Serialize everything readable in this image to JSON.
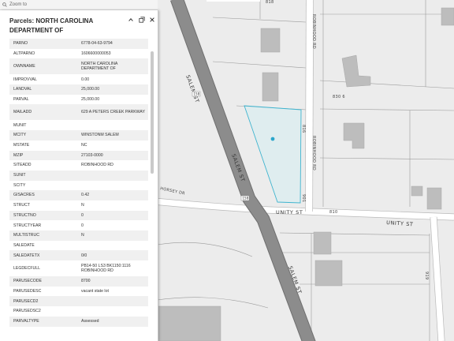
{
  "toolbar": {
    "zoom_label": "Zoom to"
  },
  "popup": {
    "title": "Parcels: NORTH CAROLINA DEPARTMENT OF",
    "rows": [
      {
        "key": "PARNO",
        "value": "6778-04-63-9794"
      },
      {
        "key": "ALTPARNO",
        "value": "1606600000053"
      },
      {
        "key": "OWNNAME",
        "value": "NORTH CAROLINA DEPARTMENT OF"
      },
      {
        "key": "IMPROVVAL",
        "value": "0.00"
      },
      {
        "key": "LANDVAL",
        "value": "25,000.00"
      },
      {
        "key": "PARVAL",
        "value": "25,000.00"
      },
      {
        "key": "MAILADD",
        "value": "629 A PETERS CREEK PARKWAY"
      },
      {
        "key": "MUNIT",
        "value": ""
      },
      {
        "key": "MCITY",
        "value": "WINSTONM SALEM"
      },
      {
        "key": "MSTATE",
        "value": "NC"
      },
      {
        "key": "MZIP",
        "value": "27103-0000"
      },
      {
        "key": "SITEADD",
        "value": "ROBINHOOD RD"
      },
      {
        "key": "SUNIT",
        "value": ""
      },
      {
        "key": "SCITY",
        "value": ""
      },
      {
        "key": "GISACRES",
        "value": "0.42"
      },
      {
        "key": "STRUCT",
        "value": "N"
      },
      {
        "key": "STRUCTNO",
        "value": "0"
      },
      {
        "key": "STRUCTYEAR",
        "value": "0"
      },
      {
        "key": "MULTISTRUC",
        "value": "N"
      },
      {
        "key": "SALEDATE",
        "value": ""
      },
      {
        "key": "SALEDATETX",
        "value": "0/0"
      },
      {
        "key": "LEGDECFULL",
        "value": "PB14-50 LS3 BK1150:1116 ROBINHOOD RD"
      },
      {
        "key": "PARUSECODE",
        "value": "8700"
      },
      {
        "key": "PARUSEDESC",
        "value": "vacant state lot"
      },
      {
        "key": "PARUSECD2",
        "value": ""
      },
      {
        "key": "PARUSEDSC2",
        "value": ""
      },
      {
        "key": "PARVALTYPE",
        "value": "Assessed"
      }
    ]
  },
  "map": {
    "colors": {
      "background": "#ececec",
      "highway": "#8c8c8c",
      "highway_edge": "#6f6f6f",
      "road": "#ffffff",
      "parcel_line": "#9a9a9a",
      "building": "#bdbdbd",
      "selection_fill": "#d6eef2",
      "selection_stroke": "#3fb4cf",
      "marker": "#2ba6cb"
    },
    "street_labels": {
      "salem_st": "SALEM ST",
      "unity_st": "UNITY ST",
      "unity_st_2": "UNITY ST",
      "robinhood_rd": "ROBINHOOD RD",
      "robinhood_rd_2": "ROBINHOOD RD",
      "horsey_dr": "HORSEY DR",
      "salem_st_2": "SALEM ST"
    },
    "parcel_numbers": {
      "p830": "830 6",
      "p816": "816",
      "p901": "901",
      "p818": "818",
      "p810": "810",
      "p919": "919"
    },
    "shields": {
      "s1": "158",
      "s2": "158"
    }
  }
}
